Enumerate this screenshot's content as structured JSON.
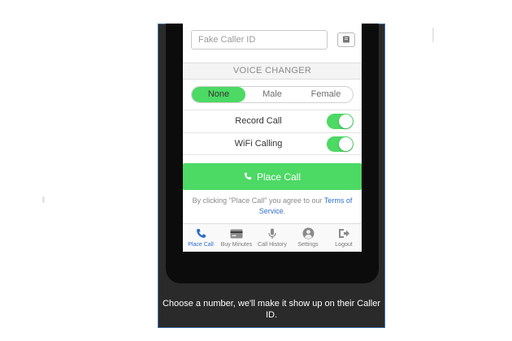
{
  "form": {
    "caller_id_placeholder": "Fake Caller ID",
    "contacts_icon": "address-book-icon"
  },
  "voice_changer": {
    "header": "VOICE CHANGER",
    "options": [
      "None",
      "Male",
      "Female"
    ],
    "selected": "None"
  },
  "settings": {
    "record_call": {
      "label": "Record Call",
      "enabled": true
    },
    "wifi_calling": {
      "label": "WiFi Calling",
      "enabled": true
    }
  },
  "place_call": {
    "label": "Place Call",
    "icon": "phone-icon"
  },
  "terms": {
    "prefix": "By clicking \"Place Call\" you agree to our ",
    "link_line1": "Terms of",
    "link_line2": "Service",
    "suffix": "."
  },
  "tabs": [
    {
      "label": "Place Call",
      "icon": "phone-icon",
      "active": true
    },
    {
      "label": "Buy Minutes",
      "icon": "credit-card-icon",
      "active": false
    },
    {
      "label": "Call History",
      "icon": "microphone-icon",
      "active": false
    },
    {
      "label": "Settings",
      "icon": "user-circle-icon",
      "active": false
    },
    {
      "label": "Logout",
      "icon": "logout-icon",
      "active": false
    }
  ],
  "caption": {
    "line1": "Choose a number, we'll make it show up on their Caller",
    "line2": "ID."
  },
  "colors": {
    "accent_green": "#4cd964",
    "link_blue": "#2f6fc7",
    "frame_bg": "#2a2a2a"
  }
}
